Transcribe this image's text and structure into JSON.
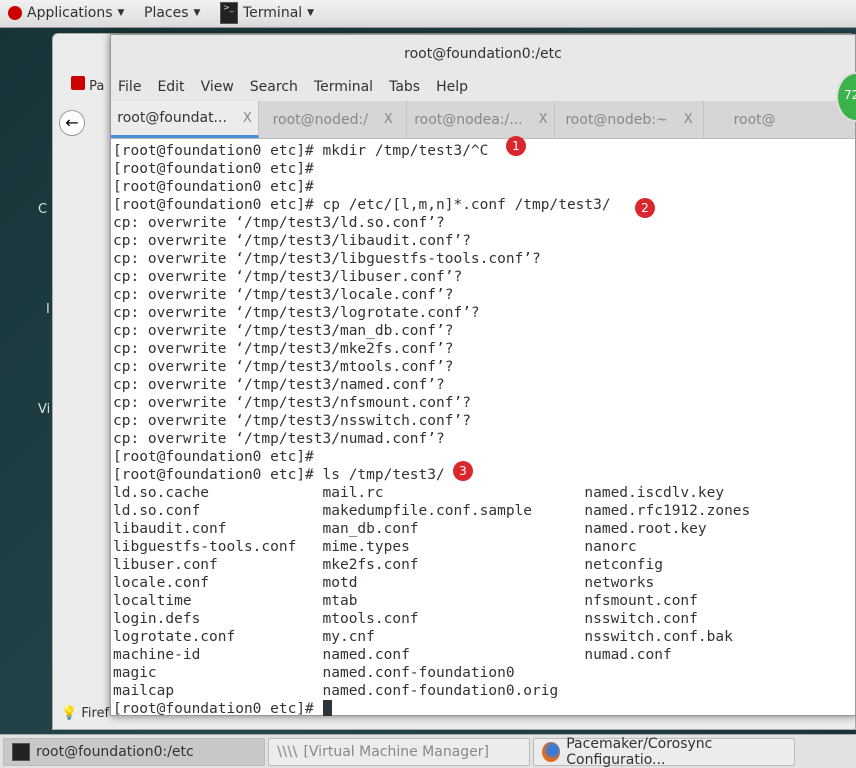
{
  "topbar": {
    "applications": "Applications",
    "places": "Places",
    "terminal": "Terminal"
  },
  "firefox": {
    "tab_partial": "Pa",
    "status_partial": "Firef"
  },
  "desktop_labels": [
    "C",
    "I",
    "Vi"
  ],
  "terminal": {
    "title": "root@foundation0:/etc",
    "menu": [
      "File",
      "Edit",
      "View",
      "Search",
      "Terminal",
      "Tabs",
      "Help"
    ],
    "tabs": [
      {
        "label": "root@foundat...",
        "active": true
      },
      {
        "label": "root@noded:/"
      },
      {
        "label": "root@nodea:/..."
      },
      {
        "label": "root@nodeb:~"
      },
      {
        "label": "root@"
      }
    ],
    "close_glyph": "X",
    "lines": [
      "[root@foundation0 etc]# mkdir /tmp/test3/^C",
      "[root@foundation0 etc]#",
      "[root@foundation0 etc]#",
      "[root@foundation0 etc]# cp /etc/[l,m,n]*.conf /tmp/test3/",
      "cp: overwrite ‘/tmp/test3/ld.so.conf’?",
      "cp: overwrite ‘/tmp/test3/libaudit.conf’?",
      "cp: overwrite ‘/tmp/test3/libguestfs-tools.conf’?",
      "cp: overwrite ‘/tmp/test3/libuser.conf’?",
      "cp: overwrite ‘/tmp/test3/locale.conf’?",
      "cp: overwrite ‘/tmp/test3/logrotate.conf’?",
      "cp: overwrite ‘/tmp/test3/man_db.conf’?",
      "cp: overwrite ‘/tmp/test3/mke2fs.conf’?",
      "cp: overwrite ‘/tmp/test3/mtools.conf’?",
      "cp: overwrite ‘/tmp/test3/named.conf’?",
      "cp: overwrite ‘/tmp/test3/nfsmount.conf’?",
      "cp: overwrite ‘/tmp/test3/nsswitch.conf’?",
      "cp: overwrite ‘/tmp/test3/numad.conf’?",
      "[root@foundation0 etc]#",
      "[root@foundation0 etc]# ls /tmp/test3/"
    ],
    "ls_rows": [
      [
        "ld.so.cache",
        "mail.rc",
        "named.iscdlv.key"
      ],
      [
        "ld.so.conf",
        "makedumpfile.conf.sample",
        "named.rfc1912.zones"
      ],
      [
        "libaudit.conf",
        "man_db.conf",
        "named.root.key"
      ],
      [
        "libguestfs-tools.conf",
        "mime.types",
        "nanorc"
      ],
      [
        "libuser.conf",
        "mke2fs.conf",
        "netconfig"
      ],
      [
        "locale.conf",
        "motd",
        "networks"
      ],
      [
        "localtime",
        "mtab",
        "nfsmount.conf"
      ],
      [
        "login.defs",
        "mtools.conf",
        "nsswitch.conf"
      ],
      [
        "logrotate.conf",
        "my.cnf",
        "nsswitch.conf.bak"
      ],
      [
        "machine-id",
        "named.conf",
        "numad.conf"
      ],
      [
        "magic",
        "named.conf-foundation0",
        ""
      ],
      [
        "mailcap",
        "named.conf-foundation0.orig",
        ""
      ]
    ],
    "prompt": "[root@foundation0 etc]# "
  },
  "badges": [
    "1",
    "2",
    "3"
  ],
  "green_badge": "72",
  "taskbar": [
    "root@foundation0:/etc",
    "[Virtual Machine Manager]",
    "Pacemaker/Corosync Configuratio..."
  ],
  "colors": {
    "badge": "#d9272e",
    "tab_accent": "#4a90d9"
  }
}
